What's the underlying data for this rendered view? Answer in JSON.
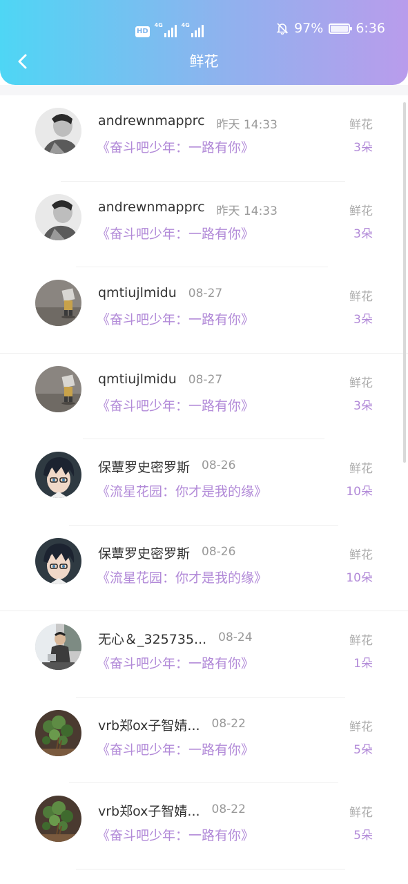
{
  "status_bar": {
    "hd_label": "HD",
    "net1": "4G",
    "net2": "4G",
    "battery_percent": "97%",
    "time": "6:36"
  },
  "header": {
    "back_icon": "chevron-left-icon",
    "title": "鲜花"
  },
  "colors": {
    "accent_purple": "#b28ad8",
    "header_gradient_start": "#4ed6f5",
    "header_gradient_end": "#b99cec"
  },
  "records": [
    {
      "name": "andrewnmapprc",
      "time": "昨天 14:33",
      "show": "《奋斗吧少年：一路有你》",
      "gift": "鲜花",
      "count": "3朵",
      "avatar": "bw-portrait"
    },
    {
      "name": "andrewnmapprc",
      "time": "昨天 14:33",
      "show": "《奋斗吧少年：一路有你》",
      "gift": "鲜花",
      "count": "3朵",
      "avatar": "bw-portrait"
    },
    {
      "name": "qmtiujlmidu",
      "time": "08-27",
      "show": "《奋斗吧少年：一路有你》",
      "gift": "鲜花",
      "count": "3朵",
      "avatar": "toy-figure"
    },
    {
      "name": "qmtiujlmidu",
      "time": "08-27",
      "show": "《奋斗吧少年：一路有你》",
      "gift": "鲜花",
      "count": "3朵",
      "avatar": "toy-figure"
    },
    {
      "name": "保蕈罗史密罗斯",
      "time": "08-26",
      "show": "《流星花园：你才是我的缘》",
      "gift": "鲜花",
      "count": "10朵",
      "avatar": "anime-boy"
    },
    {
      "name": "保蕈罗史密罗斯",
      "time": "08-26",
      "show": "《流星花园：你才是我的缘》",
      "gift": "鲜花",
      "count": "10朵",
      "avatar": "anime-boy"
    },
    {
      "name": "无心＆_325735...",
      "time": "08-24",
      "show": "《奋斗吧少年：一路有你》",
      "gift": "鲜花",
      "count": "1朵",
      "avatar": "street-photo"
    },
    {
      "name": "vrb郑ox子智婧...",
      "time": "08-22",
      "show": "《奋斗吧少年：一路有你》",
      "gift": "鲜花",
      "count": "5朵",
      "avatar": "plant"
    },
    {
      "name": "vrb郑ox子智婧...",
      "time": "08-22",
      "show": "《奋斗吧少年：一路有你》",
      "gift": "鲜花",
      "count": "5朵",
      "avatar": "plant"
    }
  ]
}
